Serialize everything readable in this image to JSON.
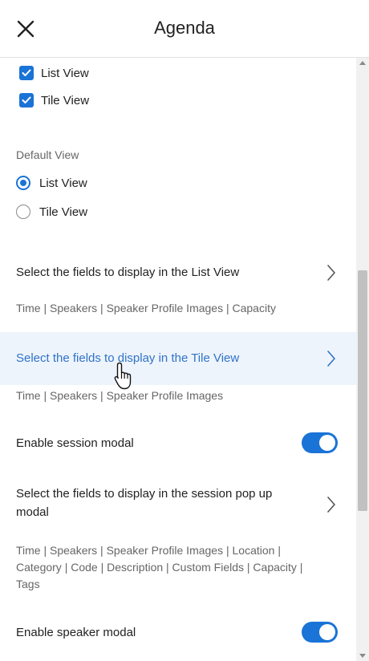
{
  "header": {
    "title": "Agenda"
  },
  "views": {
    "checkboxes": [
      {
        "label": "List View",
        "checked": true
      },
      {
        "label": "Tile View",
        "checked": true
      }
    ],
    "default_view_label": "Default View",
    "radios": [
      {
        "label": "List View",
        "selected": true
      },
      {
        "label": "Tile View",
        "selected": false
      }
    ]
  },
  "list_fields": {
    "title": "Select the fields to display in the List View",
    "summary": "Time | Speakers | Speaker Profile Images | Capacity"
  },
  "tile_fields": {
    "title": "Select the fields to display in the Tile View",
    "summary": "Time | Speakers | Speaker Profile Images"
  },
  "session_modal": {
    "label": "Enable session modal",
    "enabled": true
  },
  "session_fields": {
    "title": "Select the fields to display in the session pop up modal",
    "summary": "Time | Speakers | Speaker Profile Images | Location | Category | Code | Description | Custom Fields | Capacity | Tags"
  },
  "speaker_modal": {
    "label": "Enable speaker modal",
    "enabled": true
  },
  "colors": {
    "accent": "#1a73d6",
    "active_text": "#2f73c9",
    "active_bg": "#eef4fb"
  }
}
